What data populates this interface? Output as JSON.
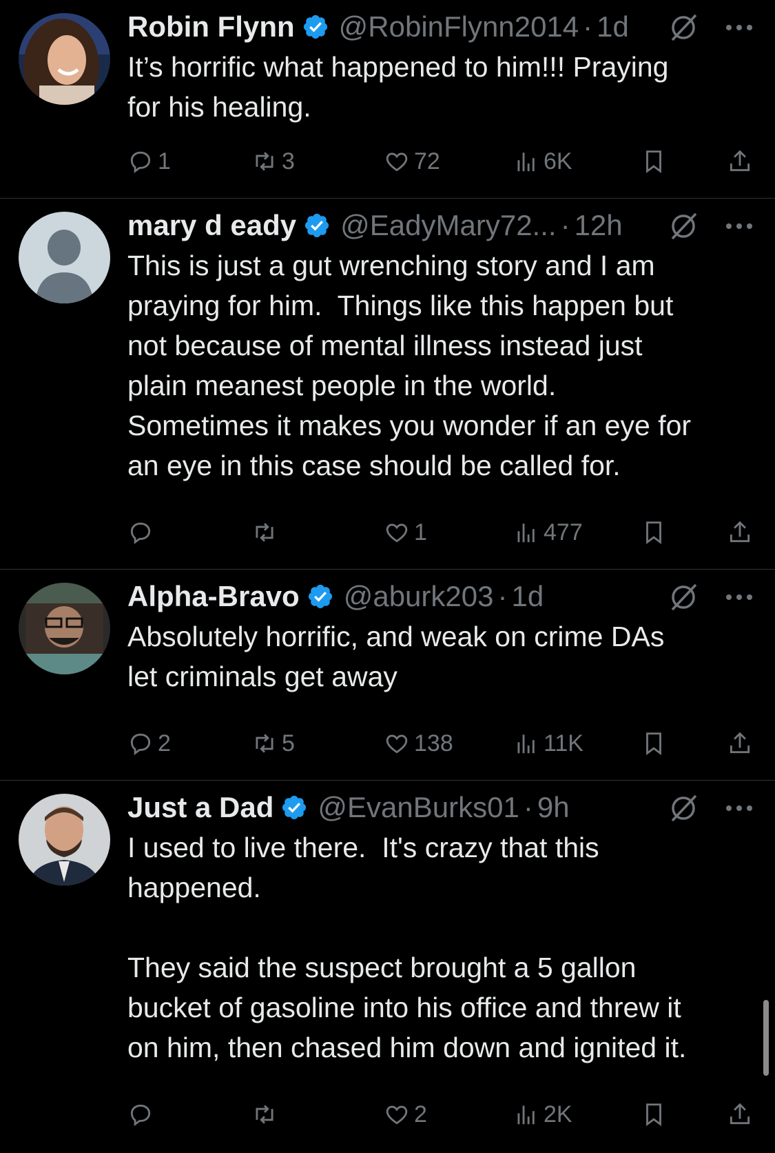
{
  "colors": {
    "background": "#000000",
    "text": "#e7e9ea",
    "muted": "#71767b",
    "verified": "#1d9bf0",
    "divider": "#2f3336"
  },
  "tweets": [
    {
      "name": "Robin Flynn",
      "handle": "@RobinFlynn2014",
      "time": "1d",
      "text": "It’s horrific what happened to him!!! Praying\nfor his healing.",
      "replies": "1",
      "reposts": "3",
      "likes": "72",
      "views": "6K",
      "avatar": "photo-woman"
    },
    {
      "name": "mary d eady",
      "handle": "@EadyMary72...",
      "time": "12h",
      "text": "This is just a gut wrenching story and I am\npraying for him.  Things like this happen but\nnot because of mental illness instead just\nplain meanest people in the world.\nSometimes it makes you wonder if an eye for\nan eye in this case should be called for.",
      "replies": "",
      "reposts": "",
      "likes": "1",
      "views": "477",
      "avatar": "default-person"
    },
    {
      "name": "Alpha-Bravo",
      "handle": "@aburk203",
      "time": "1d",
      "text": "Absolutely horrific, and weak on crime DAs\nlet criminals get away",
      "replies": "2",
      "reposts": "5",
      "likes": "138",
      "views": "11K",
      "avatar": "photo-man-glasses"
    },
    {
      "name": "Just a Dad",
      "handle": "@EvanBurks01",
      "time": "9h",
      "text": "I used to live there.  It's crazy that this\nhappened.\n\nThey said the suspect brought a 5 gallon\nbucket of gasoline into his office and threw it\non him, then chased him down and ignited it.",
      "replies": "",
      "reposts": "",
      "likes": "2",
      "views": "2K",
      "avatar": "photo-man-suit"
    }
  ],
  "icons": {
    "verified": "verified-badge-icon",
    "grok": "grok-icon",
    "more": "more-icon",
    "reply": "reply-icon",
    "repost": "repost-icon",
    "like": "like-icon",
    "views": "views-icon",
    "bookmark": "bookmark-icon",
    "share": "share-icon"
  }
}
